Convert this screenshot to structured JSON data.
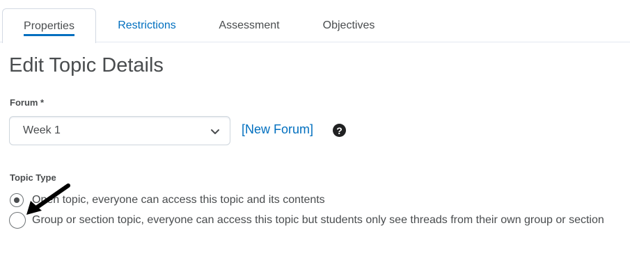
{
  "tabs": [
    {
      "label": "Properties",
      "active": true
    },
    {
      "label": "Restrictions",
      "active": false
    },
    {
      "label": "Assessment",
      "active": false
    },
    {
      "label": "Objectives",
      "active": false
    }
  ],
  "page_title": "Edit Topic Details",
  "forum": {
    "label": "Forum *",
    "selected": "Week 1",
    "new_forum_link": "[New Forum]",
    "help_icon_glyph": "?"
  },
  "topic_type": {
    "label": "Topic Type",
    "options": [
      {
        "label": "Open topic, everyone can access this topic and its contents",
        "checked": true
      },
      {
        "label": "Group or section topic, everyone can access this topic but students only see threads from their own group or section",
        "checked": false
      }
    ]
  },
  "colors": {
    "link": "#006fbf",
    "text": "#494c4e",
    "tab_indicator": "#006fbf"
  }
}
